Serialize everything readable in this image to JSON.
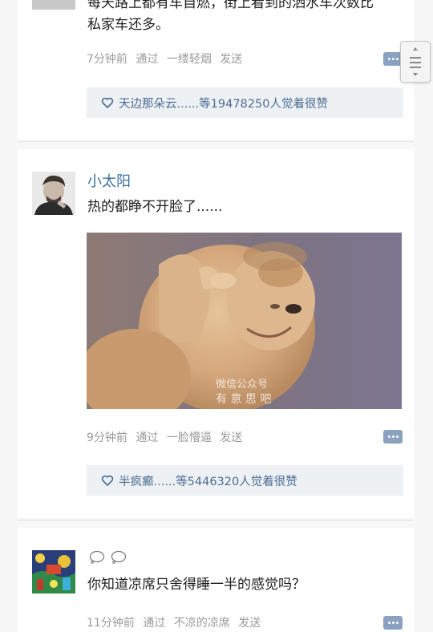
{
  "comments": [
    {
      "text_line1": "每天路上都有车自燃，街上看到的洒水车次数比",
      "text_line2": "私家车还多。",
      "time": "7分钟前",
      "via_prefix": "通过",
      "device": "一缕轻烟",
      "action": "发送",
      "likes": "天边那朵云......等19478250人觉着很赞"
    },
    {
      "username": "小太阳",
      "text": "热的都睁不开脸了......",
      "watermark_line1": "微信公众号",
      "watermark_line2": "有 意 思 吧",
      "time": "9分钟前",
      "via_prefix": "通过",
      "device": "一脸懵逼",
      "action": "发送",
      "likes": "半疯癫......等5446320人觉着很赞"
    },
    {
      "text": "你知道凉席只舍得睡一半的感觉吗？",
      "time": "11分钟前",
      "via_prefix": "通过",
      "device": "不凉的凉席",
      "action": "发送"
    }
  ],
  "icons": {
    "reply": "reply-icon",
    "like": "heart-outline-icon",
    "scroll": "scroll-handle-icon",
    "bubble": "thought-bubble-icon"
  },
  "colors": {
    "username": "#3a6f9d",
    "meta": "#9a9a9a",
    "likes_bg": "#eef1f4",
    "likes_text": "#4b6d93",
    "reply_btn": "#8aa1bf"
  }
}
